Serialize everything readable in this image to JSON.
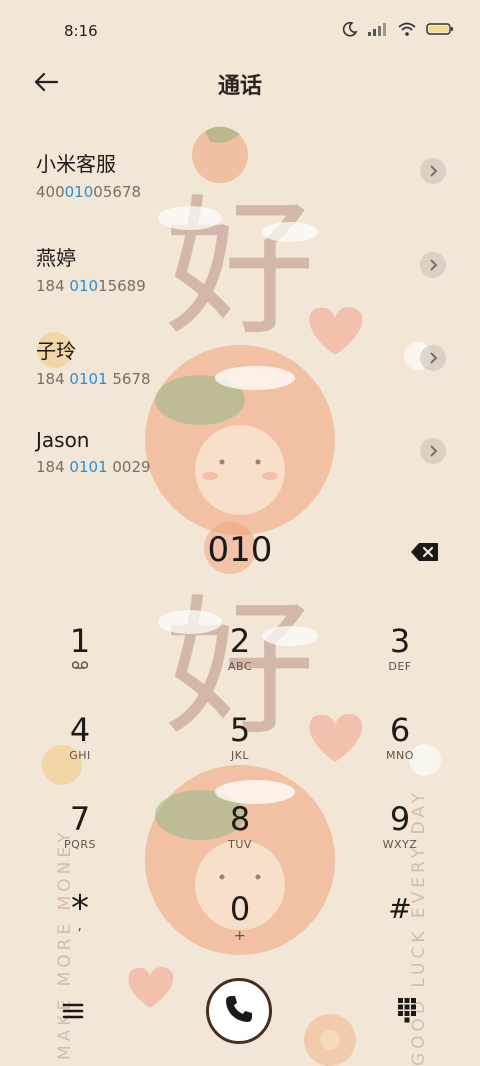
{
  "status_bar": {
    "time": "8:16",
    "icons": [
      "moon-icon",
      "signal-icon",
      "wifi-icon",
      "battery-icon"
    ]
  },
  "header": {
    "title": "通话",
    "back_icon": "arrow-left-icon"
  },
  "contacts": [
    {
      "name": "小米客服",
      "num_pre": "400",
      "num_hl": "010",
      "num_post": "05678"
    },
    {
      "name": "燕婷",
      "num_pre": "184 ",
      "num_hl": "010",
      "num_post": "15689"
    },
    {
      "name": "子玲",
      "num_pre": "184 ",
      "num_hl": "0101",
      "num_post": " 5678"
    },
    {
      "name": "Jason",
      "num_pre": "184 ",
      "num_hl": "0101",
      "num_post": " 0029"
    }
  ],
  "dialer": {
    "input": "010",
    "keys": [
      {
        "digit": "1",
        "letters": ""
      },
      {
        "digit": "2",
        "letters": "ABC"
      },
      {
        "digit": "3",
        "letters": "DEF"
      },
      {
        "digit": "4",
        "letters": "GHI"
      },
      {
        "digit": "5",
        "letters": "JKL"
      },
      {
        "digit": "6",
        "letters": "MNO"
      },
      {
        "digit": "7",
        "letters": "PQRS"
      },
      {
        "digit": "8",
        "letters": "TUV"
      },
      {
        "digit": "9",
        "letters": "WXYZ"
      },
      {
        "digit": "*",
        "letters": ","
      },
      {
        "digit": "0",
        "letters": "+"
      },
      {
        "digit": "#",
        "letters": ""
      }
    ]
  },
  "wallpaper": {
    "left_text": "MAKE MORE MONEY",
    "right_text": "GOOD LUCK EVERY DAY",
    "big_char": "好"
  },
  "colors": {
    "background": "#f2e6d6",
    "highlight": "#2a8fd6",
    "call_ring": "#4a2d20"
  }
}
